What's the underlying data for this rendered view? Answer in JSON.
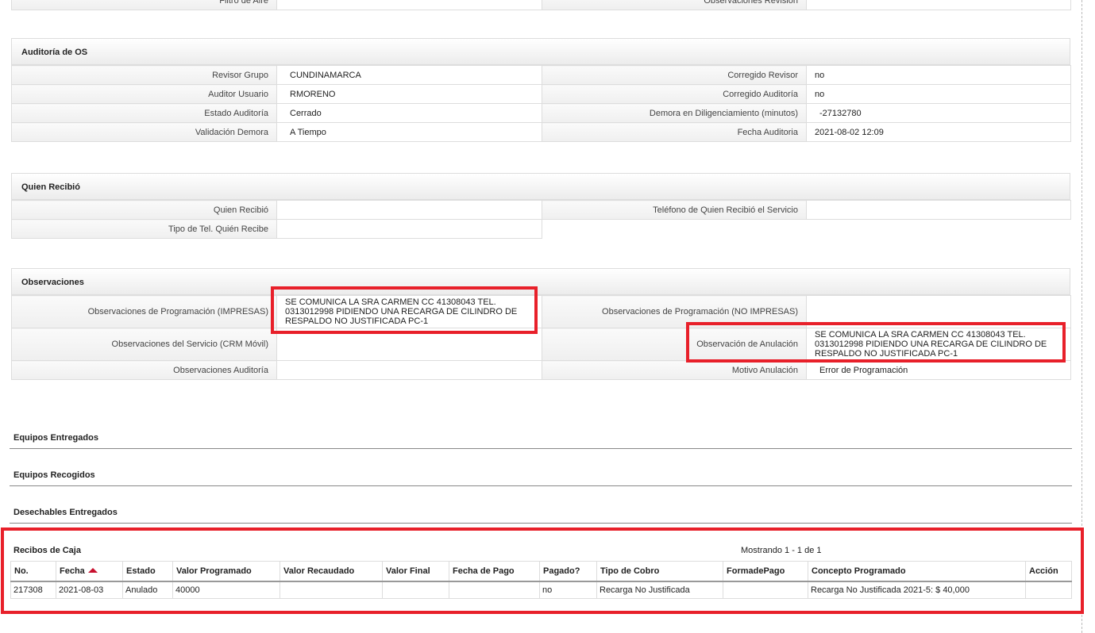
{
  "top_row": {
    "left_label": "Filtro de Aire",
    "left_value": "",
    "right_label": "Observaciones Revisión",
    "right_value": ""
  },
  "auditoria": {
    "title": "Auditoría de OS",
    "rows": [
      {
        "l_label": "Revisor Grupo",
        "l_value": "CUNDINAMARCA",
        "r_label": "Corregido Revisor",
        "r_value": "no"
      },
      {
        "l_label": "Auditor Usuario",
        "l_value": "RMORENO",
        "r_label": "Corregido Auditoría",
        "r_value": "no"
      },
      {
        "l_label": "Estado Auditoría",
        "l_value": "Cerrado",
        "r_label": "Demora en Diligenciamiento (minutos)",
        "r_value": "-27132780"
      },
      {
        "l_label": "Validación Demora",
        "l_value": "A Tiempo",
        "r_label": "Fecha Auditoria",
        "r_value": "2021-08-02 12:09"
      }
    ]
  },
  "quien_recibio": {
    "title": "Quien Recibió",
    "row1": {
      "l_label": "Quien Recibió",
      "l_value": "",
      "r_label": "Teléfono de Quien Recibió el Servicio",
      "r_value": ""
    },
    "row2": {
      "l_label": "Tipo de Tel. Quién Recibe",
      "l_value": ""
    }
  },
  "observaciones": {
    "title": "Observaciones",
    "prog_impresas_label": "Observaciones de Programación (IMPRESAS)",
    "prog_impresas_value": "SE COMUNICA LA SRA CARMEN CC 41308043 TEL. 0313012998 PIDIENDO UNA RECARGA DE CILINDRO DE RESPALDO NO JUSTIFICADA PC-1",
    "prog_no_impresas_label": "Observaciones de Programación (NO IMPRESAS)",
    "prog_no_impresas_value": "",
    "servicio_label": "Observaciones del Servicio (CRM Móvil)",
    "servicio_value": "",
    "anulacion_label": "Observación de Anulación",
    "anulacion_value": "SE COMUNICA LA SRA CARMEN CC 41308043 TEL. 0313012998 PIDIENDO UNA RECARGA DE CILINDRO DE RESPALDO NO JUSTIFICADA PC-1",
    "auditoria_label": "Observaciones Auditoría",
    "auditoria_value": "",
    "motivo_label": "Motivo Anulación",
    "motivo_value": "Error de Programación"
  },
  "sections": {
    "equipos_entregados": "Equipos Entregados",
    "equipos_recogidos": "Equipos Recogidos",
    "desechables_entregados": "Desechables Entregados"
  },
  "recibos": {
    "title": "Recibos de Caja",
    "paging": "Mostrando 1 - 1 de 1",
    "columns": [
      "No.",
      "Fecha",
      "Estado",
      "Valor Programado",
      "Valor Recaudado",
      "Valor Final",
      "Fecha de Pago",
      "Pagado?",
      "Tipo de Cobro",
      "FormadePago",
      "Concepto Programado",
      "Acción"
    ],
    "rows": [
      [
        "217308",
        "2021-08-03",
        "Anulado",
        "40000",
        "",
        "",
        "",
        "no",
        "Recarga No Justificada",
        "",
        "Recarga No Justificada 2021-5: $ 40,000",
        ""
      ]
    ]
  },
  "highlight_color": "#e8202a"
}
